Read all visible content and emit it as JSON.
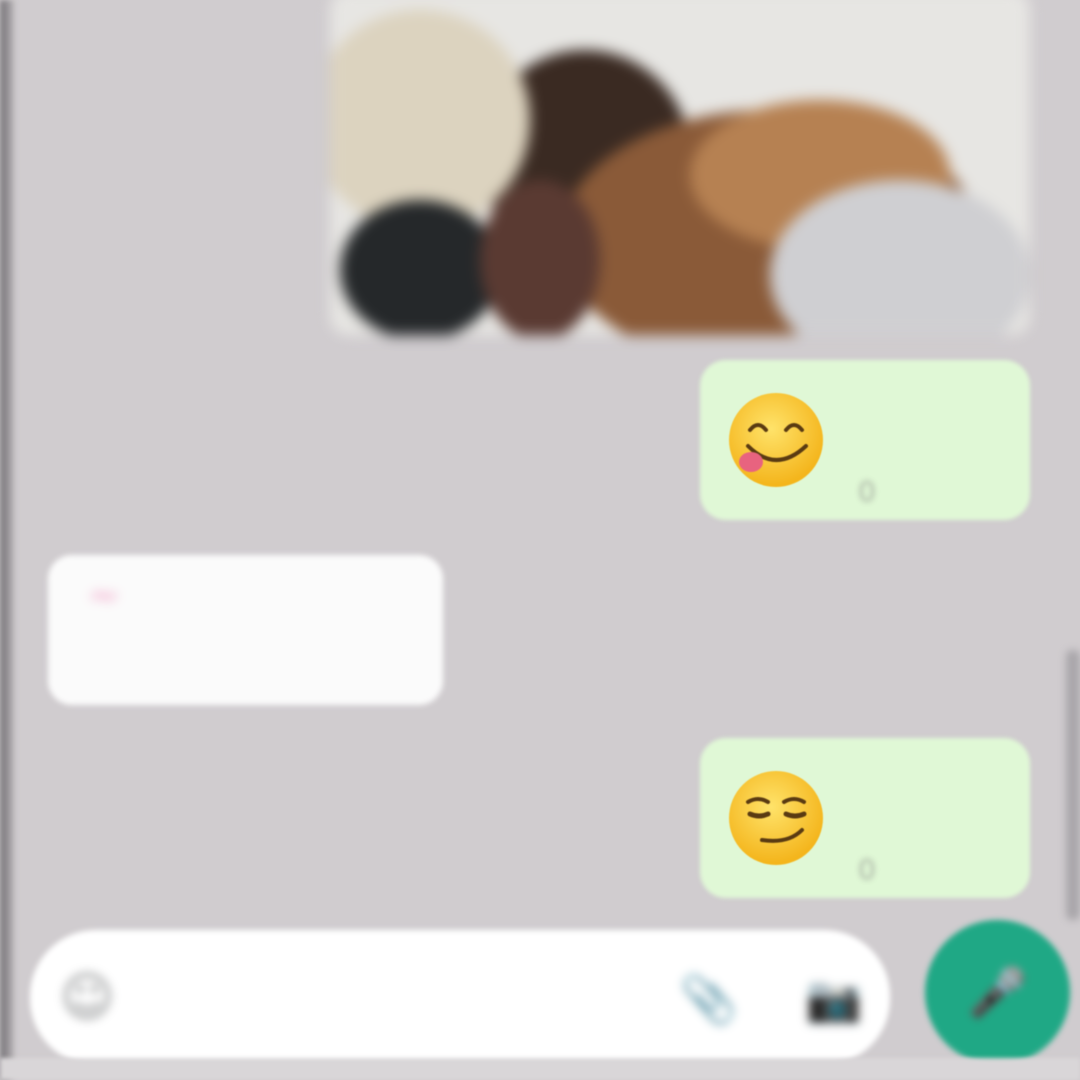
{
  "chat": {
    "messages": [
      {
        "kind": "image",
        "direction": "outgoing",
        "description_icon": "photo"
      },
      {
        "kind": "emoji",
        "direction": "outgoing",
        "emoji": "😋",
        "time": "0"
      },
      {
        "kind": "text",
        "direction": "incoming",
        "sender": "~ ",
        "text": "",
        "time": ""
      },
      {
        "kind": "emoji",
        "direction": "outgoing",
        "emoji": "😏",
        "time": "0"
      }
    ]
  },
  "composer": {
    "emoji_icon": "☺",
    "placeholder": "",
    "attach_icon": "📎",
    "camera_icon": "📷",
    "mic_icon": "🎤"
  },
  "colors": {
    "wallpaper": "#d0cccf",
    "outgoing_bubble": "#e0f8d6",
    "incoming_bubble": "#fbfbfb",
    "accent": "#1fa885"
  }
}
